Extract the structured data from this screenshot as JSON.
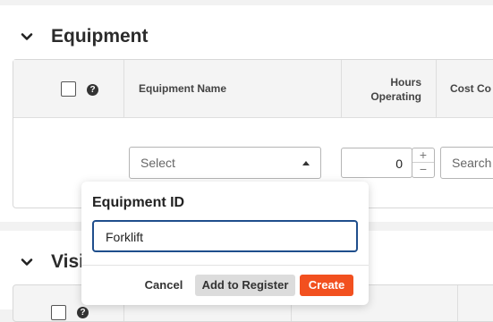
{
  "equipment_section": {
    "title": "Equipment",
    "columns": {
      "name": "Equipment Name",
      "hours_line1": "Hours",
      "hours_line2": "Operating",
      "cost": "Cost Co"
    },
    "row": {
      "select_placeholder": "Select",
      "hours_value": "0",
      "search_placeholder": "Search"
    }
  },
  "second_section": {
    "title": "Visi"
  },
  "popover": {
    "title": "Equipment ID",
    "input_value": "Forklift",
    "buttons": {
      "cancel": "Cancel",
      "add": "Add to Register",
      "create": "Create"
    }
  },
  "colors": {
    "accent": "#f2501f",
    "focus": "#1f4e8c"
  },
  "icons": {
    "collapse": "chevron-down-icon",
    "help": "question-circle-icon",
    "select": "caret-up-icon"
  }
}
